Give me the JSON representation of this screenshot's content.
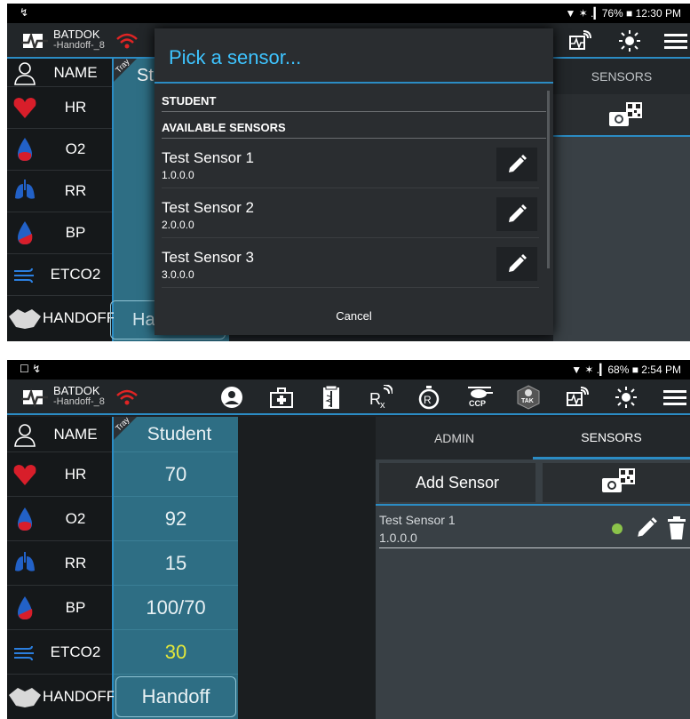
{
  "shot1": {
    "status": {
      "left": "↯",
      "right": "▼ ✶ .▎76% ■ 12:30 PM"
    },
    "brand": {
      "name": "BATDOK",
      "sub": "-Handoff-_8"
    },
    "vitals": [
      "NAME",
      "HR",
      "O2",
      "RR",
      "BP",
      "ETCO2",
      "HANDOFF"
    ],
    "student_partial": "St",
    "handoff_partial": "Ha",
    "tray_label": "Tray",
    "sensors_tab": "SENSORS",
    "dialog": {
      "title": "Pick a sensor...",
      "section_student": "STUDENT",
      "section_available": "AVAILABLE SENSORS",
      "sensors": [
        {
          "name": "Test Sensor 1",
          "version": "1.0.0.0"
        },
        {
          "name": "Test Sensor 2",
          "version": "2.0.0.0"
        },
        {
          "name": "Test Sensor 3",
          "version": "3.0.0.0"
        }
      ],
      "cancel": "Cancel"
    }
  },
  "shot2": {
    "status": {
      "left": "☐ ↯",
      "right": "▼ ✶ .▎68% ■ 2:54 PM"
    },
    "brand": {
      "name": "BATDOK",
      "sub": "-Handoff-_8"
    },
    "toolbar_icons": [
      "user-icon",
      "medical-kit-icon",
      "caduceus-icon",
      "rx-icon",
      "stopwatch-icon",
      "ccp-helicopter-icon",
      "tak-icon",
      "sensor-signal-icon",
      "brightness-icon",
      "menu-icon"
    ],
    "toolbar_ccp_label": "CCP",
    "toolbar_tak_label": "TAK",
    "vitals": [
      "NAME",
      "HR",
      "O2",
      "RR",
      "BP",
      "ETCO2",
      "HANDOFF"
    ],
    "tray_label": "Tray",
    "student": {
      "header": "Student",
      "values": [
        "70",
        "92",
        "15",
        "100/70",
        "30"
      ],
      "handoff_button": "Handoff"
    },
    "tabs": [
      "ADMIN",
      "SENSORS"
    ],
    "add_sensor": "Add Sensor",
    "sensor": {
      "name": "Test Sensor 1",
      "version": "1.0.0.0",
      "status_color": "#8bc34a"
    },
    "colors": {
      "accent": "#2b8cc4",
      "etco2_value": "#e4e83a",
      "dialog_title": "#3ec4ff"
    }
  }
}
